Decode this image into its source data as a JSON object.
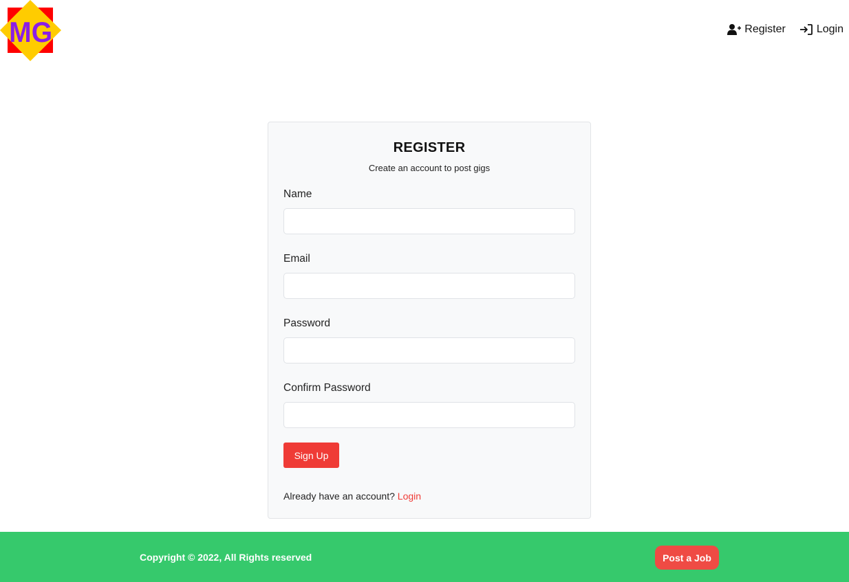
{
  "logo": {
    "text": "MG",
    "colors": {
      "square": "#ff0000",
      "diamond": "#ffcc00",
      "letters": "#8a1ee6"
    }
  },
  "nav": {
    "register_label": "Register",
    "register_icon": "user-plus-icon",
    "login_label": "Login",
    "login_icon": "sign-in-icon"
  },
  "form": {
    "title": "REGISTER",
    "subtitle": "Create an account to post gigs",
    "fields": [
      {
        "label": "Name",
        "value": "",
        "placeholder": ""
      },
      {
        "label": "Email",
        "value": "",
        "placeholder": ""
      },
      {
        "label": "Password",
        "value": "",
        "placeholder": ""
      },
      {
        "label": "Confirm Password",
        "value": "",
        "placeholder": ""
      }
    ],
    "submit_label": "Sign Up",
    "login_prompt": "Already have an account?",
    "login_link": "Login"
  },
  "footer": {
    "copyright": "Copyright © 2022, All Rights reserved",
    "post_job_label": "Post a Job"
  },
  "colors": {
    "accent": "#ef3b36",
    "footer_bg": "#36c96c",
    "card_bg": "#f8f9fa"
  }
}
